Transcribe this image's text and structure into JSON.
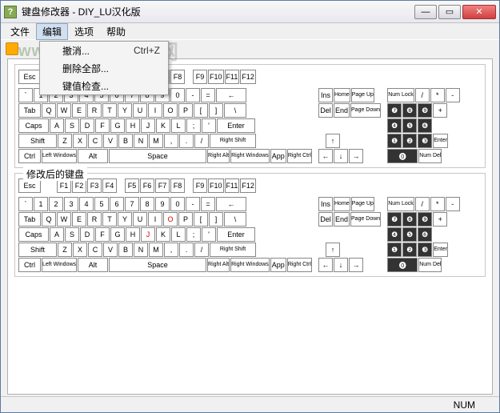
{
  "window": {
    "title": "键盘修改器 - DIY_LU汉化版",
    "min_label": "—",
    "max_label": "▭",
    "close_label": "✕"
  },
  "menubar": {
    "items": [
      "文件",
      "编辑",
      "选项",
      "帮助"
    ],
    "active_index": 1
  },
  "dropdown": {
    "items": [
      {
        "label": "撤消...",
        "shortcut": "Ctrl+Z"
      },
      {
        "label": "删除全部..."
      },
      {
        "label": "键值检查..."
      }
    ]
  },
  "panel2_label": "修改后的键盘",
  "keys": {
    "esc": "Esc",
    "func": [
      "F1",
      "F2",
      "F3",
      "F4",
      "F5",
      "F6",
      "F7",
      "F8",
      "F9",
      "F10",
      "F11",
      "F12"
    ],
    "row1": [
      "`",
      "1",
      "2",
      "3",
      "4",
      "5",
      "6",
      "7",
      "8",
      "9",
      "0",
      "-",
      "="
    ],
    "backspace": "←",
    "tab": "Tab",
    "row2": [
      "Q",
      "W",
      "E",
      "R",
      "T",
      "Y",
      "U",
      "I",
      "O",
      "P",
      "[",
      "]"
    ],
    "backslash": "\\",
    "caps": "Caps",
    "row3": [
      "A",
      "S",
      "D",
      "F",
      "G",
      "H",
      "J",
      "K",
      "L",
      ";",
      "'"
    ],
    "enter": "Enter",
    "lshift": "Shift",
    "row4": [
      "Z",
      "X",
      "C",
      "V",
      "B",
      "N",
      "M",
      ",",
      ".",
      "/"
    ],
    "rshift": "Right Shift",
    "ctrl": "Ctrl",
    "lwin": "Left Windows",
    "alt": "Alt",
    "space": "Space",
    "ralt": "Right Alt",
    "rwin": "Right Windows",
    "app": "App",
    "rctrl": "Right Ctrl",
    "ins": "Ins",
    "home": "Home",
    "pgup": "Page Up",
    "del": "Del",
    "end": "End",
    "pgdn": "Page Down",
    "up": "↑",
    "down": "↓",
    "left": "←",
    "right": "→",
    "numlock": "Num Lock",
    "numdiv": "/",
    "nummul": "*",
    "numsub": "-",
    "n7": "❼",
    "n8": "❽",
    "n9": "❾",
    "nadd": "+",
    "n4": "❹",
    "n5": "❺",
    "n6": "❻",
    "n1": "❶",
    "n2": "❷",
    "n3": "❸",
    "nent": "Enter",
    "n0": "⓿",
    "ndel": "Num Del"
  },
  "modified": {
    "o_key": "O",
    "j_key": "J"
  },
  "statusbar": {
    "num": "NUM"
  },
  "watermark": "www.pc0359.cn",
  "watermark_cn": "河东软件网"
}
